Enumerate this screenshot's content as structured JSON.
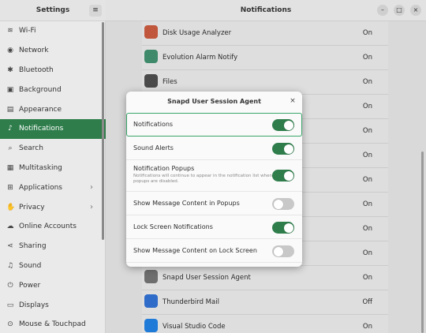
{
  "sidebar": {
    "title": "Settings",
    "menu_icon": "hamburger-icon",
    "items": [
      {
        "label": "Wi-Fi",
        "icon": "wifi-icon",
        "glyph": "≋"
      },
      {
        "label": "Network",
        "icon": "network-icon",
        "glyph": "◉"
      },
      {
        "label": "Bluetooth",
        "icon": "bluetooth-icon",
        "glyph": "✱"
      },
      {
        "label": "Background",
        "icon": "background-icon",
        "glyph": "▣"
      },
      {
        "label": "Appearance",
        "icon": "appearance-icon",
        "glyph": "▤"
      },
      {
        "label": "Notifications",
        "icon": "bell-icon",
        "glyph": "♪",
        "active": true
      },
      {
        "label": "Search",
        "icon": "search-icon",
        "glyph": "⌕"
      },
      {
        "label": "Multitasking",
        "icon": "multitasking-icon",
        "glyph": "▦"
      },
      {
        "label": "Applications",
        "icon": "applications-icon",
        "glyph": "⊞",
        "chevron": "›"
      },
      {
        "label": "Privacy",
        "icon": "privacy-icon",
        "glyph": "✋",
        "chevron": "›"
      },
      {
        "label": "Online Accounts",
        "icon": "online-accounts-icon",
        "glyph": "☁"
      },
      {
        "label": "Sharing",
        "icon": "sharing-icon",
        "glyph": "⋖"
      },
      {
        "label": "Sound",
        "icon": "sound-icon",
        "glyph": "♫"
      },
      {
        "label": "Power",
        "icon": "power-icon",
        "glyph": "⏻"
      },
      {
        "label": "Displays",
        "icon": "displays-icon",
        "glyph": "▭"
      },
      {
        "label": "Mouse & Touchpad",
        "icon": "mouse-icon",
        "glyph": "⊙"
      }
    ]
  },
  "header": {
    "title": "Notifications",
    "minimize": "–",
    "maximize": "□",
    "close": "×"
  },
  "apps": [
    {
      "name": "Disk Usage Analyzer",
      "value": "On",
      "icon": "disk-usage-analyzer-icon",
      "color": "#c0563b"
    },
    {
      "name": "Evolution Alarm Notify",
      "value": "On",
      "icon": "evolution-alarm-icon",
      "color": "#3f8a6a"
    },
    {
      "name": "Files",
      "value": "On",
      "icon": "files-icon",
      "color": "#4a4a4a"
    },
    {
      "name": "",
      "value": "On",
      "icon": "app-icon",
      "color": "#8b8b8b"
    },
    {
      "name": "",
      "value": "On",
      "icon": "app-icon",
      "color": "#8b8b8b"
    },
    {
      "name": "",
      "value": "On",
      "icon": "app-icon",
      "color": "#8b8b8b"
    },
    {
      "name": "",
      "value": "On",
      "icon": "app-icon",
      "color": "#8b8b8b"
    },
    {
      "name": "",
      "value": "On",
      "icon": "app-icon",
      "color": "#8b8b8b"
    },
    {
      "name": "",
      "value": "On",
      "icon": "app-icon",
      "color": "#8b8b8b"
    },
    {
      "name": "",
      "value": "On",
      "icon": "app-icon",
      "color": "#8b8b8b"
    },
    {
      "name": "Snapd User Session Agent",
      "value": "On",
      "icon": "gear-icon",
      "color": "#6e6e6e"
    },
    {
      "name": "Thunderbird Mail",
      "value": "Off",
      "icon": "thunderbird-icon",
      "color": "#2f6bc9"
    },
    {
      "name": "Visual Studio Code",
      "value": "On",
      "icon": "vscode-icon",
      "color": "#1f7ad8"
    }
  ],
  "dialog": {
    "title": "Snapd User Session Agent",
    "close": "×",
    "options": [
      {
        "label": "Notifications",
        "on": true,
        "focused": true
      },
      {
        "label": "Sound Alerts",
        "on": true
      },
      {
        "label": "Notification Popups",
        "sub": "Notifications will continue to appear in the notification list when popups are disabled.",
        "on": true,
        "tall": true
      },
      {
        "label": "Show Message Content in Popups",
        "on": false
      },
      {
        "label": "Lock Screen Notifications",
        "on": true
      },
      {
        "label": "Show Message Content on Lock Screen",
        "on": false
      }
    ]
  },
  "colors": {
    "accent": "#2e7d4b",
    "toggle_off": "#c8c8c8"
  }
}
